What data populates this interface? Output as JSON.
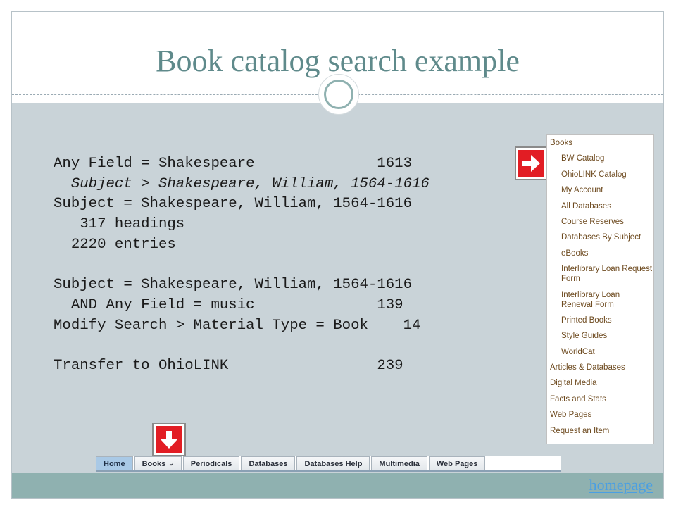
{
  "slide": {
    "title": "Book catalog search example"
  },
  "search_lines": [
    {
      "text": "Any Field = Shakespeare              1613",
      "italic": false
    },
    {
      "text": "  Subject > Shakespeare, William, 1564-1616",
      "italic": true
    },
    {
      "text": "Subject = Shakespeare, William, 1564-1616",
      "italic": false
    },
    {
      "text": "   317 headings",
      "italic": false
    },
    {
      "text": "  2220 entries",
      "italic": false
    },
    {
      "text": "",
      "italic": false
    },
    {
      "text": "Subject = Shakespeare, William, 1564-1616",
      "italic": false
    },
    {
      "text": "  AND Any Field = music              139",
      "italic": false
    },
    {
      "text": "Modify Search > Material Type = Book    14",
      "italic": false
    },
    {
      "text": "",
      "italic": false
    },
    {
      "text": "Transfer to OhioLINK                 239",
      "italic": false
    }
  ],
  "nav_panel": {
    "items": [
      {
        "label": "Books",
        "level": 0
      },
      {
        "label": "BW Catalog",
        "level": 1
      },
      {
        "label": "OhioLINK Catalog",
        "level": 1
      },
      {
        "label": "My Account",
        "level": 1
      },
      {
        "label": "All Databases",
        "level": 1
      },
      {
        "label": "Course Reserves",
        "level": 1
      },
      {
        "label": "Databases By Subject",
        "level": 1
      },
      {
        "label": "eBooks",
        "level": 1
      },
      {
        "label": "Interlibrary Loan Request Form",
        "level": 1
      },
      {
        "label": "Interlibrary Loan Renewal Form",
        "level": 1
      },
      {
        "label": "Printed Books",
        "level": 1
      },
      {
        "label": "Style Guides",
        "level": 1
      },
      {
        "label": "WorldCat",
        "level": 1
      },
      {
        "label": "Articles & Databases",
        "level": 0
      },
      {
        "label": "Digital Media",
        "level": 0
      },
      {
        "label": "Facts and Stats",
        "level": 0
      },
      {
        "label": "Web Pages",
        "level": 0
      },
      {
        "label": "Request an Item",
        "level": 0
      }
    ]
  },
  "tabs": [
    {
      "label": "Home",
      "active": true,
      "dropdown": false
    },
    {
      "label": "Books",
      "active": false,
      "dropdown": true
    },
    {
      "label": "Periodicals",
      "active": false,
      "dropdown": false
    },
    {
      "label": "Databases",
      "active": false,
      "dropdown": false
    },
    {
      "label": "Databases Help",
      "active": false,
      "dropdown": false
    },
    {
      "label": "Multimedia",
      "active": false,
      "dropdown": false
    },
    {
      "label": "Web Pages",
      "active": false,
      "dropdown": false
    }
  ],
  "footer": {
    "homepage_link": "homepage"
  },
  "colors": {
    "title": "#5f8a8b",
    "content_bg": "#c9d3d8",
    "footer_bg": "#8fb1b0",
    "arrow_red": "#e21d24",
    "nav_text": "#6e4b20",
    "link": "#4a9fe3"
  },
  "icons": {
    "arrow_right": "red-arrow-right-icon",
    "arrow_down": "red-arrow-down-icon"
  }
}
